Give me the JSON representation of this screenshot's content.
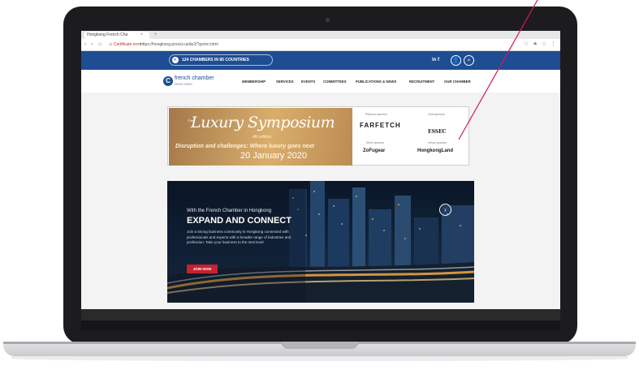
{
  "browser": {
    "tab_title": "Hongkong French Cha",
    "tab_close": "×",
    "new_tab": "+",
    "nav_back": "‹",
    "nav_forward": "›",
    "nav_home": "⌂",
    "certificate_error": "⚠ Certificate error",
    "url": "https://hongkong.proxsl.ca/de2/?go/en.html",
    "right_icons": [
      "☆",
      "★",
      "☆",
      "⋮"
    ]
  },
  "site": {
    "header": {
      "pill_icon": "◐",
      "pill_text": "124 CHAMBERS IN 85 COUNTRIES",
      "social_label": "in f",
      "user_icon": "👤",
      "search_icon": "⌕"
    },
    "logo": {
      "mark": "C",
      "name": "french chamber",
      "tagline": "HONG KONG"
    },
    "nav": [
      "MEMBERSHIP",
      "SERVICES",
      "EVENTS",
      "COMMITTEES",
      "PUBLICATIONS & NEWS",
      "RECRUITMENT",
      "OUR CHAMBER"
    ],
    "banner": {
      "small": "The",
      "title": "Luxury Symposium",
      "edition": "4th edition",
      "tagline": "Disruption and challenges: Where luxury goes next",
      "date": "20 January 2020",
      "sponsors": [
        {
          "label": "Platinum sponsor",
          "name": "FARFETCH"
        },
        {
          "label": "Gold sponsor",
          "name": "ESSEC"
        },
        {
          "label": "Silver sponsor",
          "name": "ZoFugear"
        },
        {
          "label": "Venue sponsor",
          "name": "HongkongLand"
        }
      ]
    },
    "hero": {
      "kicker": "With the French Chamber in Hongkong",
      "title": "EXPAND AND CONNECT",
      "body": "Join a strong business community in Hongkong connected with professionals and experts with a broader range of industries and profession. Take your business to the next level.",
      "button": "JOIN NOW",
      "next_arrow": "›"
    }
  },
  "accent_colors": {
    "header_blue": "#1f4d93",
    "join_red": "#c8212f",
    "annotation_line": "#d1195a"
  }
}
